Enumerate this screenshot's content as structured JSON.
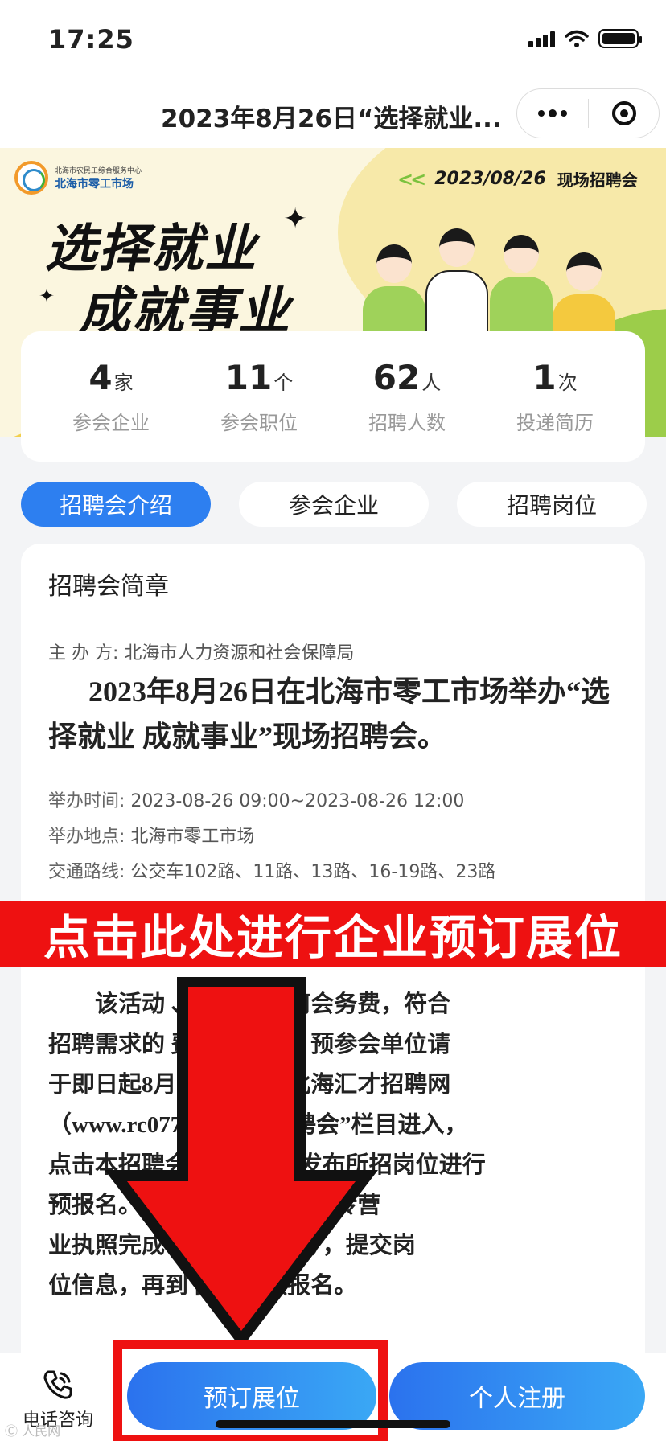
{
  "status_bar": {
    "time": "17:25"
  },
  "header": {
    "title": "2023年8月26日“选择就业..."
  },
  "banner": {
    "org_sub": "北海市农民工综合服务中心",
    "org_name": "北海市零工市场",
    "chevrons": "<<",
    "date": "2023/08/26",
    "fair_label": "现场招聘会",
    "slogan_line1": "选择就业",
    "slogan_line2": "成就事业",
    "colors": {
      "yellow": "#f2cf4c",
      "green": "#9ccd4a"
    }
  },
  "stats": [
    {
      "value": "4",
      "unit": "家",
      "label": "参会企业"
    },
    {
      "value": "11",
      "unit": "个",
      "label": "参会职位"
    },
    {
      "value": "62",
      "unit": "人",
      "label": "招聘人数"
    },
    {
      "value": "1",
      "unit": "次",
      "label": "投递简历"
    }
  ],
  "tabs": [
    {
      "label": "招聘会介绍",
      "active": true
    },
    {
      "label": "参会企业",
      "active": false
    },
    {
      "label": "招聘岗位",
      "active": false
    }
  ],
  "content": {
    "title": "招聘会简章",
    "organizer": "主  办  方:  北海市人力资源和社会保障局",
    "headline": "2023年8月26日在北海市零工市场举办“选择就业 成就事业”现场招聘会。",
    "time_label": "举办时间:",
    "time_value": "2023-08-26 09:00~2023-08-26 12:00",
    "place_label": "举办地点:",
    "place_value": "北海市零工市场",
    "route_label": "交通路线:",
    "route_value": "公交车102路、11路、13路、16-19路、23路",
    "body_lines": [
      "该活动                  、不收取任何会务费，符合",
      "招聘需求的              费报名参加。预参会单位请",
      "于即日起8月            0前，登录北海汇才招聘网",
      "（www.rc077            页点击“招聘会”栏目进入，",
      "点击本招聘会      订”并编辑发布所招岗位进行",
      "预报名。            注册企业账户，上传营",
      "业执照完成          有本公司公章），提交岗",
      "位信息，再到        面进行预报名。"
    ]
  },
  "annotation": {
    "banner_text": "点击此处进行企业预订展位",
    "color": "#ee1111"
  },
  "bottom_bar": {
    "phone_label": "电话咨询",
    "book_label": "预订展位",
    "register_label": "个人注册"
  },
  "watermark": "Ⓒ 人民网"
}
